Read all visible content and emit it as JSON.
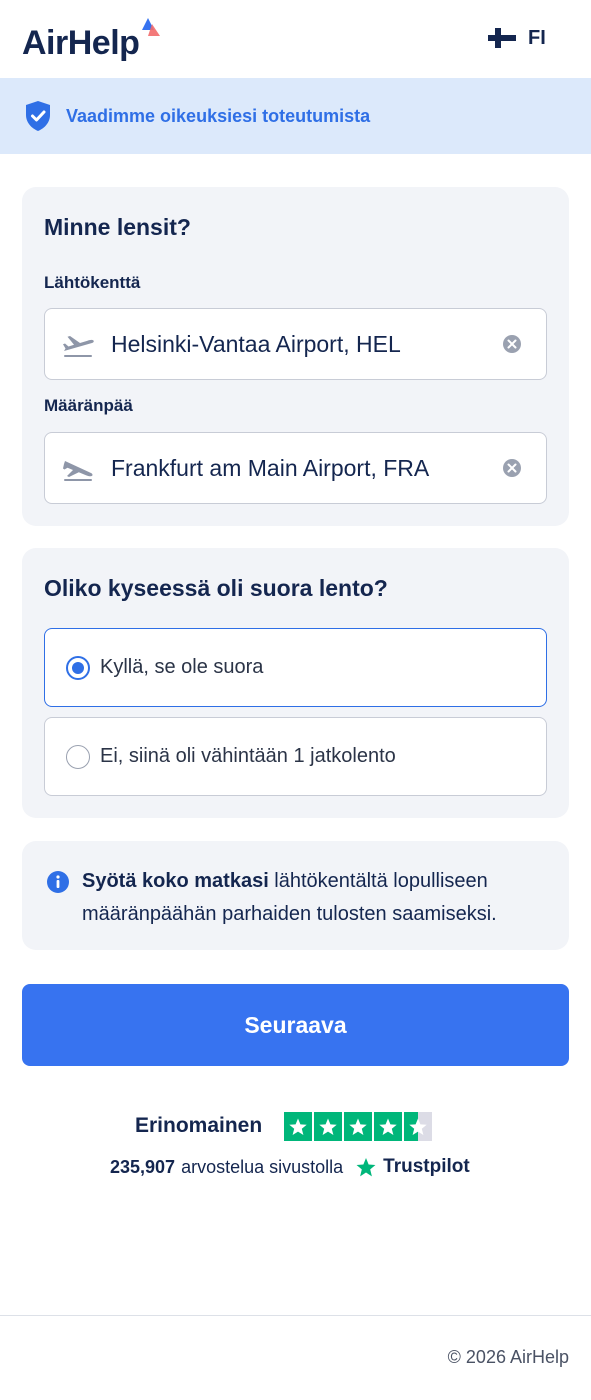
{
  "header": {
    "logo_text": "AirHelp",
    "language_code": "FI",
    "flag_icon": "finland-flag-icon"
  },
  "banner": {
    "icon": "shield-check-icon",
    "text": "Vaadimme oikeuksiesi toteutumista"
  },
  "route_card": {
    "title": "Minne lensit?",
    "departure": {
      "label": "Lähtökenttä",
      "value": "Helsinki-Vantaa Airport, HEL",
      "icon": "plane-takeoff-icon"
    },
    "destination": {
      "label": "Määränpää",
      "value": "Frankfurt am Main Airport, FRA",
      "icon": "plane-landing-icon"
    }
  },
  "direct_card": {
    "title": "Oliko kyseessä oli suora lento?",
    "options": [
      {
        "label": "Kyllä, se ole suora",
        "selected": true
      },
      {
        "label": "Ei, siinä oli vähintään 1 jatkolento",
        "selected": false
      }
    ]
  },
  "info_card": {
    "icon": "info-icon",
    "bold": "Syötä koko matkasi",
    "text": " lähtökentältä lopulliseen määränpäähän parhaiden tulosten saamiseksi."
  },
  "next_button": {
    "label": "Seuraava"
  },
  "trustpilot": {
    "rating_word": "Erinomainen",
    "stars": 4.5,
    "review_count": "235,907",
    "review_text": "arvostelua sivustolla",
    "brand": "Trustpilot"
  },
  "footer": {
    "copyright": "© 2026 AirHelp"
  },
  "colors": {
    "primary": "#3773f0",
    "navy": "#14264f",
    "banner_bg": "#dce9fb",
    "card_bg": "#f2f4f8",
    "trustpilot_green": "#00b67a"
  }
}
